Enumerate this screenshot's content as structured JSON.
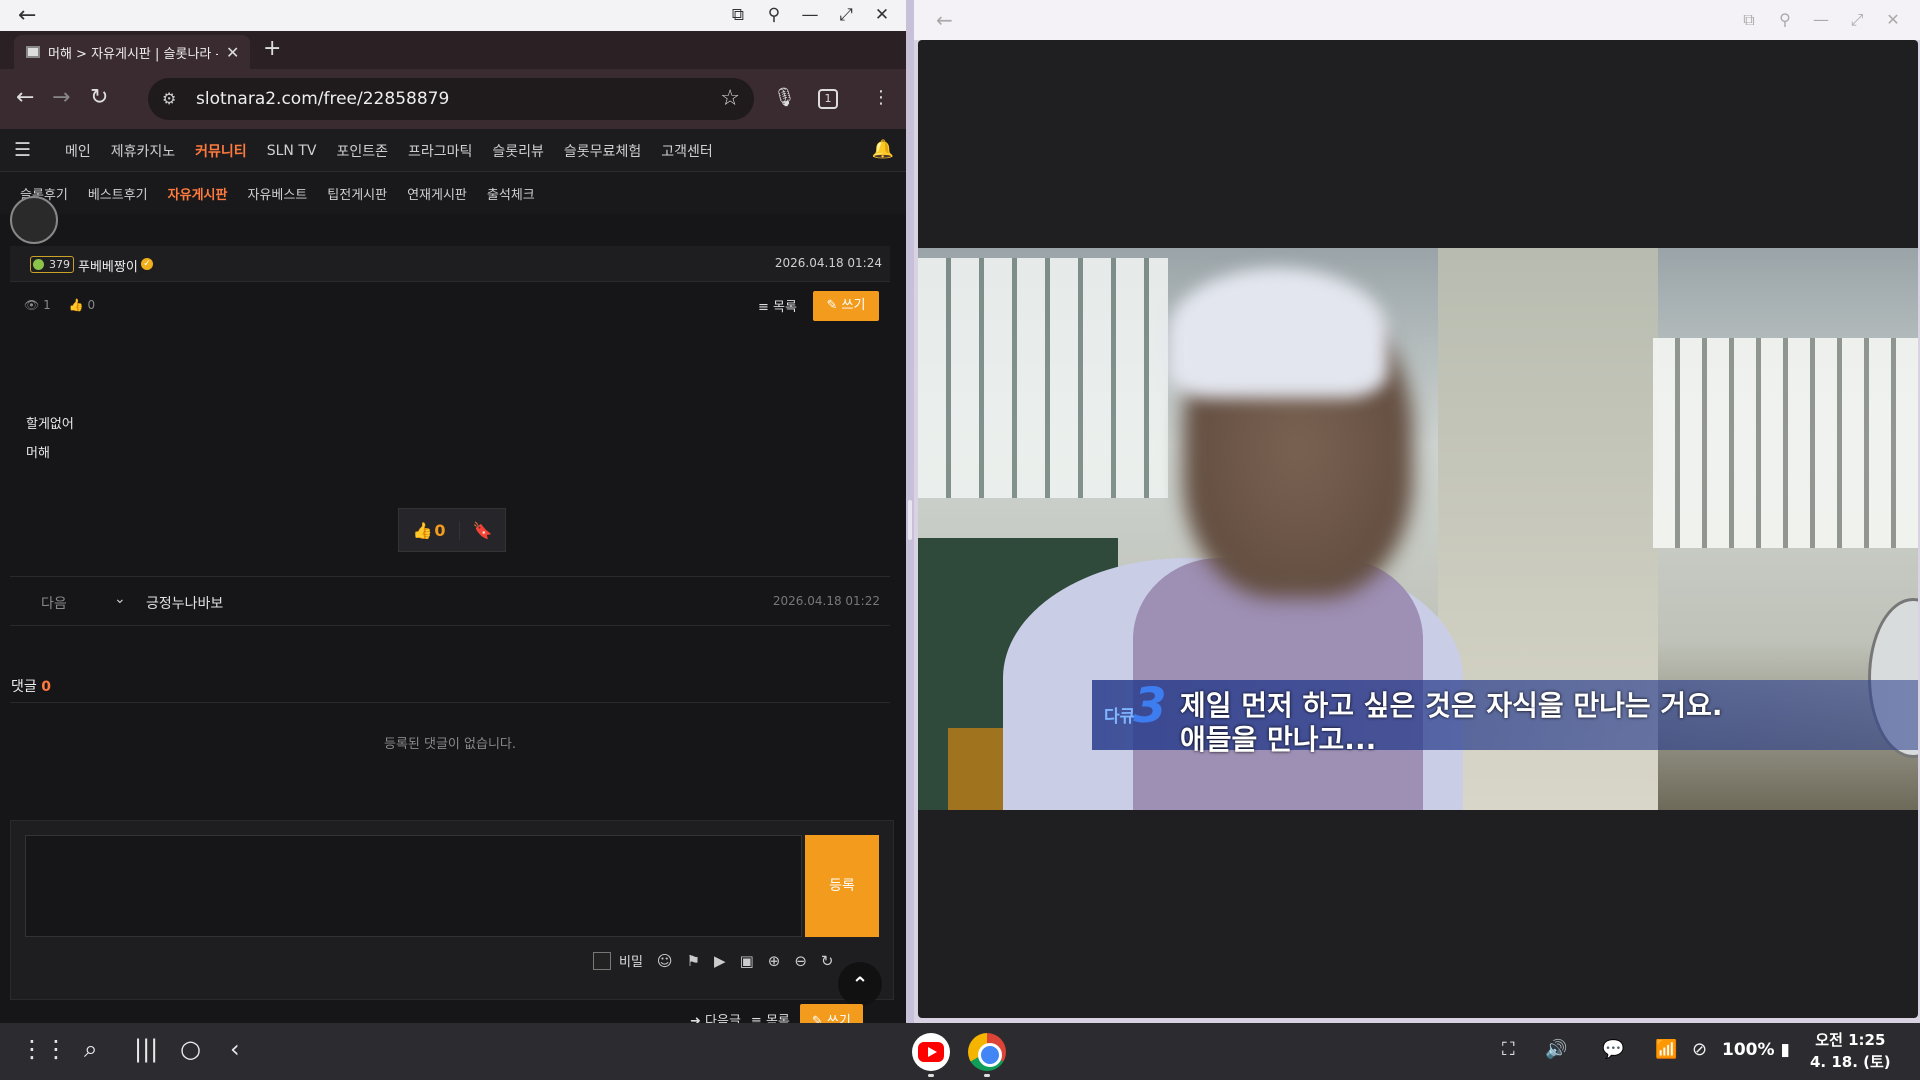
{
  "browser": {
    "tab_title": "머해 > 자유게시판 | 슬롯나라 -",
    "url": "slotnara2.com/free/22858879",
    "tab_count": "1"
  },
  "site": {
    "gnb": [
      "메인",
      "제휴카지노",
      "커뮤니티",
      "SLN TV",
      "포인트존",
      "프라그마틱",
      "슬롯리뷰",
      "슬롯무료체험",
      "고객센터"
    ],
    "gnb_active": "커뮤니티",
    "subnav": [
      "슬롯후기",
      "베스트후기",
      "자유게시판",
      "자유베스트",
      "팁전게시판",
      "연재게시판",
      "출석체크"
    ],
    "subnav_active": "자유게시판"
  },
  "post": {
    "level": "379",
    "author": "푸베베짱이",
    "date": "2026.04.18 01:24",
    "views": "1",
    "likes": "0",
    "list_label": "목록",
    "write_label": "쓰기",
    "body_lines": [
      "할게없어",
      "머해"
    ],
    "vote_count": "0"
  },
  "next": {
    "label": "다음",
    "title": "긍정누나바보",
    "date": "2026.04.18 01:22"
  },
  "comments": {
    "label": "댓글",
    "count": "0",
    "empty_text": "등록된 댓글이 없습니다.",
    "submit_label": "등록",
    "secret_label": "비밀"
  },
  "bottom": {
    "next_label": "다음글",
    "list_label": "목록",
    "write_label": "쓰기"
  },
  "video": {
    "logo_text": "다큐",
    "logo_num": "3",
    "subtitle_line1": "제일 먼저 하고 싶은 것은 자식을 만나는 거요.",
    "subtitle_line2": "애들을 만나고..."
  },
  "status": {
    "battery": "100%",
    "time": "오전 1:25",
    "date": "4. 18. (토)"
  },
  "colors": {
    "accent_orange": "#f29b1c",
    "active_nav": "#ff7a3d"
  }
}
